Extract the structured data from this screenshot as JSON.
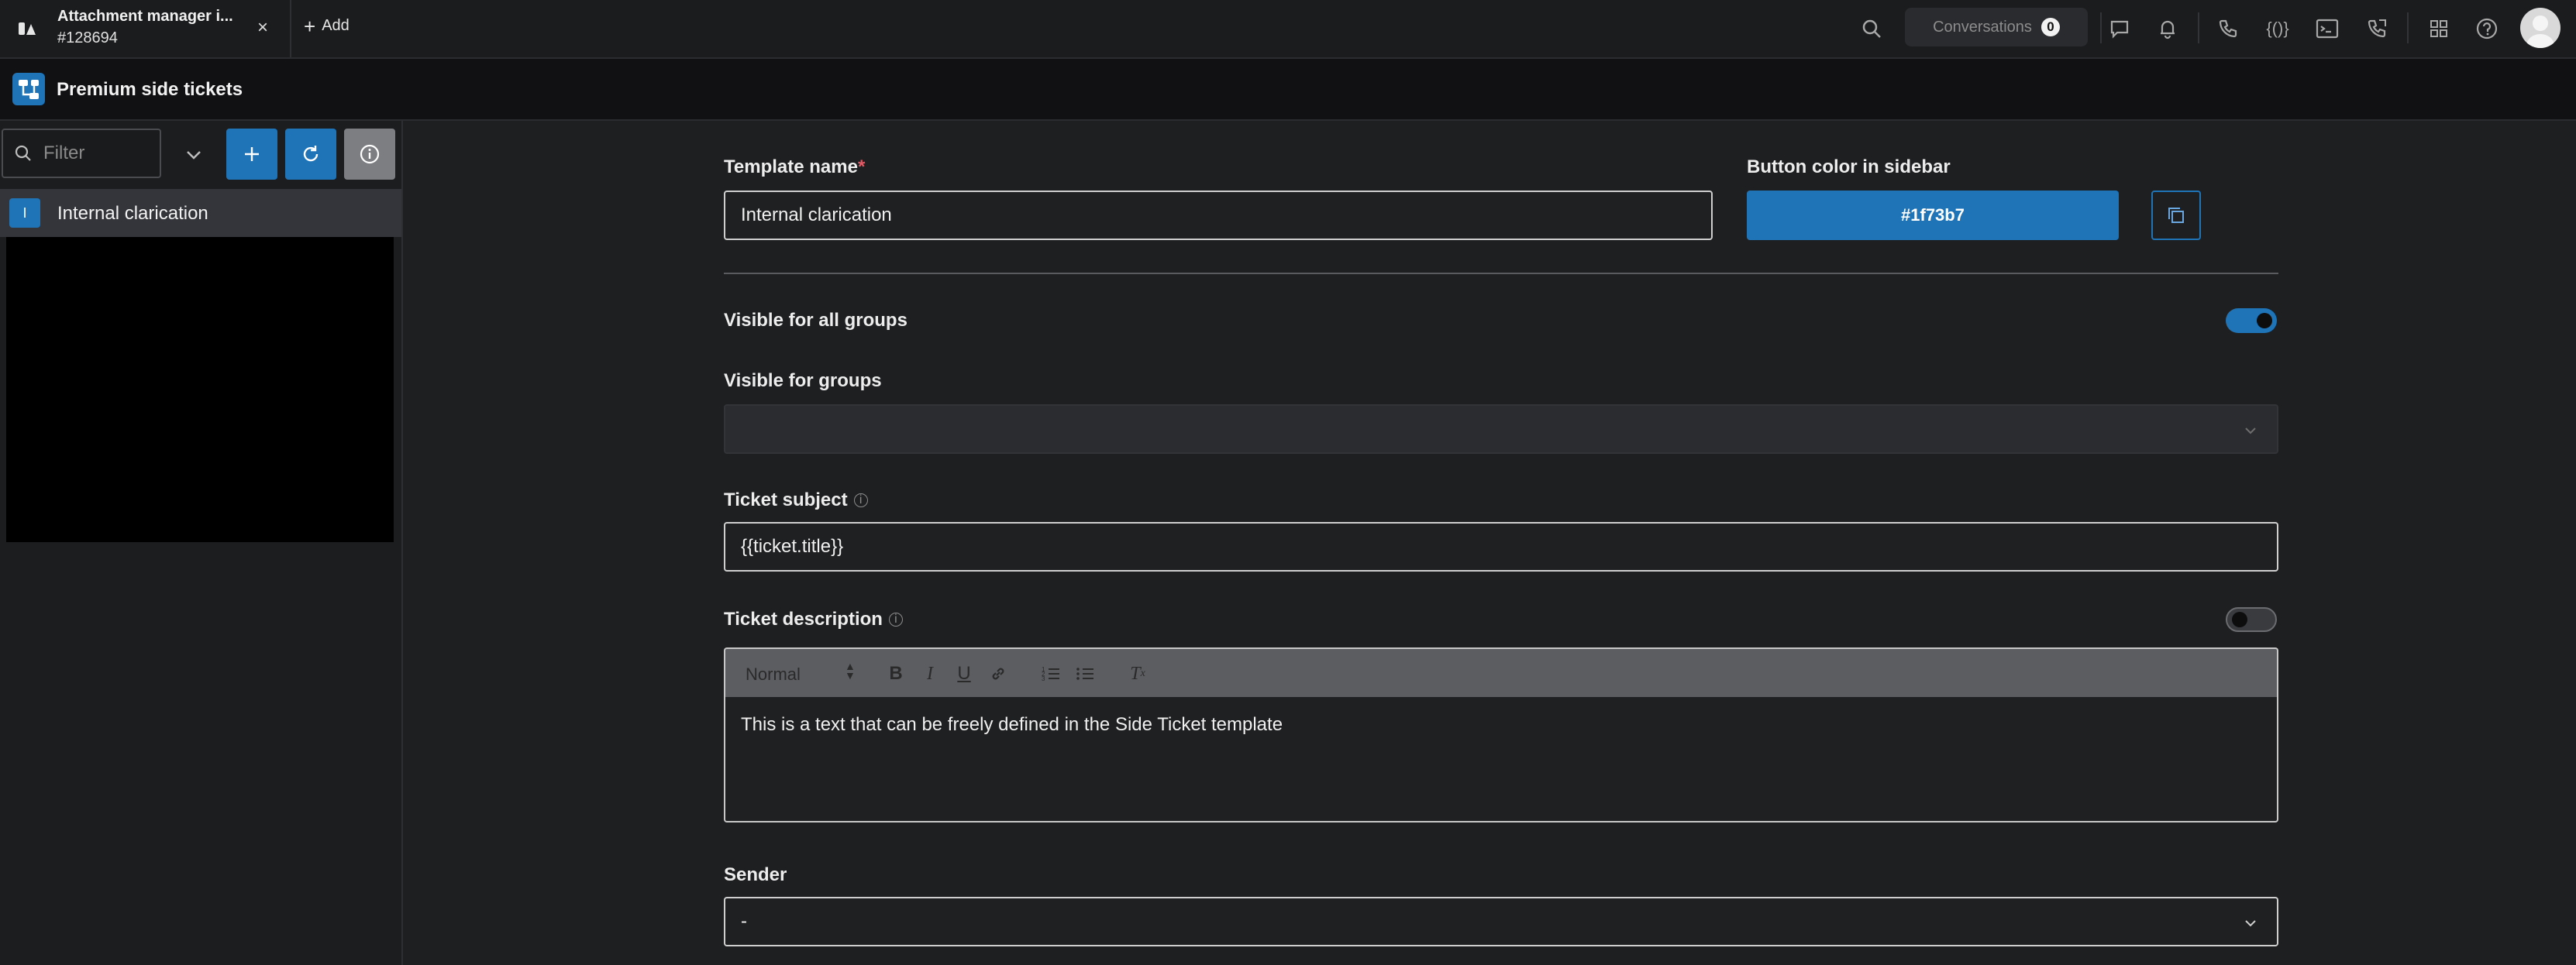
{
  "topbar": {
    "tab_title": "Attachment manager i...",
    "tab_subtitle": "#128694",
    "tab_close": "×",
    "add_label": "Add",
    "conversations_label": "Conversations",
    "conversations_count": "0"
  },
  "app": {
    "title": "Premium side tickets"
  },
  "sidebar": {
    "filter_placeholder": "Filter",
    "items": [
      {
        "initial": "I",
        "label": "Internal clarication"
      }
    ]
  },
  "form": {
    "template_name_label": "Template name",
    "required_mark": "*",
    "template_name_value": "Internal clarication",
    "button_color_label": "Button color in sidebar",
    "button_color_value": "#1f73b7",
    "visible_all_groups_label": "Visible for all groups",
    "visible_all_groups_on": true,
    "visible_groups_label": "Visible for groups",
    "visible_groups_value": "",
    "ticket_subject_label": "Ticket subject",
    "ticket_subject_value": "{{ticket.title}}",
    "ticket_description_label": "Ticket description",
    "ticket_description_toggle_on": false,
    "editor_format": "Normal",
    "ticket_description_value": "This is a text that can be freely defined in the Side Ticket template",
    "sender_label": "Sender",
    "sender_value": "-"
  },
  "colors": {
    "accent": "#1f73b7",
    "required": "#e35b66"
  },
  "icons": [
    "app-logo-icon",
    "close-icon",
    "plus-icon",
    "search-icon",
    "chat-icon",
    "bell-icon",
    "phone-icon",
    "code-braces-icon",
    "terminal-icon",
    "phone-forward-icon",
    "grid-icon",
    "help-icon",
    "avatar-icon",
    "chevron-down-icon",
    "refresh-icon",
    "info-icon",
    "copy-icon",
    "bold-icon",
    "italic-icon",
    "underline-icon",
    "link-icon",
    "ordered-list-icon",
    "bullet-list-icon",
    "clear-format-icon"
  ]
}
